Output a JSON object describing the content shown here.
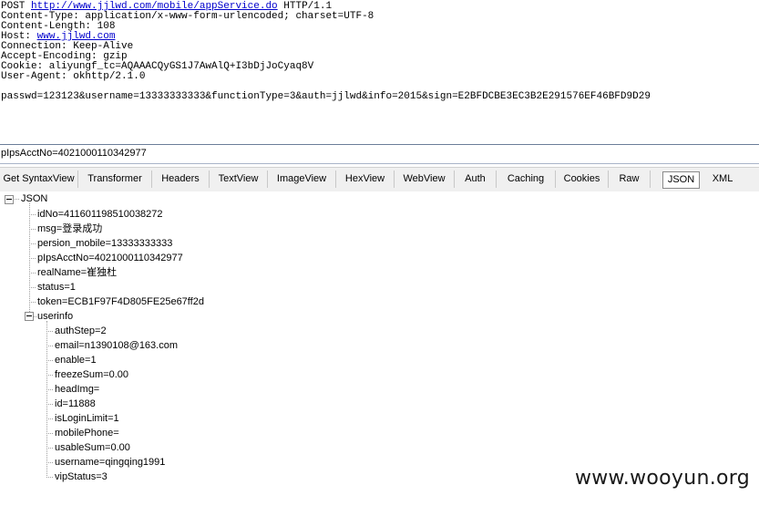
{
  "request": {
    "method": "POST",
    "url": "http://www.jjlwd.com/mobile/appService.do",
    "protocol": "HTTP/1.1",
    "content_type": "Content-Type: application/x-www-form-urlencoded; charset=UTF-8",
    "content_length": "Content-Length: 108",
    "host_label": "Host:",
    "host": "www.jjlwd.com",
    "connection": "Connection: Keep-Alive",
    "accept_encoding": "Accept-Encoding: gzip",
    "cookie": "Cookie: aliyungf_tc=AQAAACQyGS1J7AwAlQ+I3bDjJoCyaq8V",
    "user_agent": "User-Agent: okhttp/2.1.0",
    "body": "passwd=123123&username=13333333333&functionType=3&auth=jjlwd&info=2015&sign=E2BFDCBE3EC3B2E291576EF46BFD9D29"
  },
  "response_bar": {
    "text": "pIpsAcctNo=4021000110342977"
  },
  "tabs": [
    {
      "label": "Get SyntaxView"
    },
    {
      "label": "Transformer"
    },
    {
      "label": "Headers"
    },
    {
      "label": "TextView"
    },
    {
      "label": "ImageView"
    },
    {
      "label": "HexView"
    },
    {
      "label": "WebView"
    },
    {
      "label": "Auth"
    },
    {
      "label": "Caching"
    },
    {
      "label": "Cookies"
    },
    {
      "label": "Raw"
    },
    {
      "label": "JSON"
    },
    {
      "label": "XML"
    }
  ],
  "active_tab": "JSON",
  "tree": {
    "root": "JSON",
    "fields": [
      "idNo=411601198510038272",
      "msg=登录成功",
      "persion_mobile=13333333333",
      "pIpsAcctNo=4021000110342977",
      "realName=崔独杜",
      "status=1",
      "token=ECB1F97F4D805FE25e67ff2d"
    ],
    "userinfo_label": "userinfo",
    "userinfo": [
      "authStep=2",
      "email=n1390108@163.com",
      "enable=1",
      "freezeSum=0.00",
      "headImg=",
      "id=11888",
      "isLoginLimit=1",
      "mobilePhone=",
      "usableSum=0.00",
      "username=qingqing1991",
      "vipStatus=3"
    ]
  },
  "watermark": "www.wooyun.org"
}
